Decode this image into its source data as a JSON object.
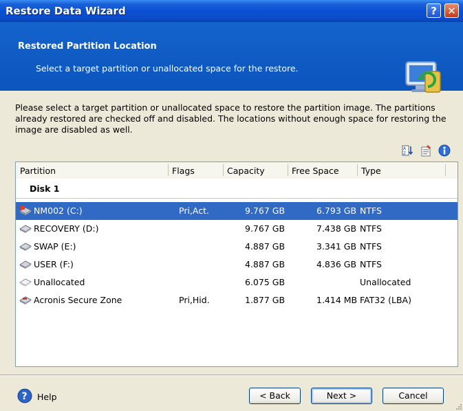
{
  "window": {
    "title": "Restore Data Wizard",
    "help_label": "?",
    "close_label": "✕"
  },
  "header": {
    "title": "Restored Partition Location",
    "subtitle": "Select a target partition or unallocated space for the restore."
  },
  "intro": "Please select a target partition or unallocated space to restore the partition image. The partitions already restored are checked off and disabled. The locations without enough space for restoring the image are disabled as well.",
  "toolbar": {
    "icons": [
      "sort-icon",
      "properties-icon",
      "info-icon"
    ]
  },
  "table": {
    "columns": [
      "Partition",
      "Flags",
      "Capacity",
      "Free Space",
      "Type"
    ],
    "disk_label": "Disk 1",
    "rows": [
      {
        "name": "NM002 (C:)",
        "flags": "Pri,Act.",
        "capacity": "9.767 GB",
        "free": "6.793 GB",
        "type": "NTFS",
        "selected": true,
        "icon": "system-disk-icon"
      },
      {
        "name": "RECOVERY (D:)",
        "flags": "",
        "capacity": "9.767 GB",
        "free": "7.438 GB",
        "type": "NTFS",
        "icon": "disk-icon"
      },
      {
        "name": "SWAP (E:)",
        "flags": "",
        "capacity": "4.887 GB",
        "free": "3.341 GB",
        "type": "NTFS",
        "icon": "disk-icon"
      },
      {
        "name": "USER (F:)",
        "flags": "",
        "capacity": "4.887 GB",
        "free": "4.836 GB",
        "type": "NTFS",
        "icon": "disk-icon"
      },
      {
        "name": "Unallocated",
        "flags": "",
        "capacity": "6.075 GB",
        "free": "",
        "type": "Unallocated",
        "icon": "unallocated-disk-icon"
      },
      {
        "name": "Acronis Secure Zone",
        "flags": "Pri,Hid.",
        "capacity": "1.877 GB",
        "free": "1.414 MB",
        "type": "FAT32 (LBA)",
        "icon": "secure-zone-icon"
      }
    ]
  },
  "footer": {
    "help_label": "Help",
    "back_label": "< Back",
    "next_label": "Next >",
    "cancel_label": "Cancel"
  },
  "colors": {
    "titlebar": "#0a4fd4",
    "header": "#0e5fc6",
    "selection": "#316ac5",
    "dialog": "#ece9d8"
  }
}
